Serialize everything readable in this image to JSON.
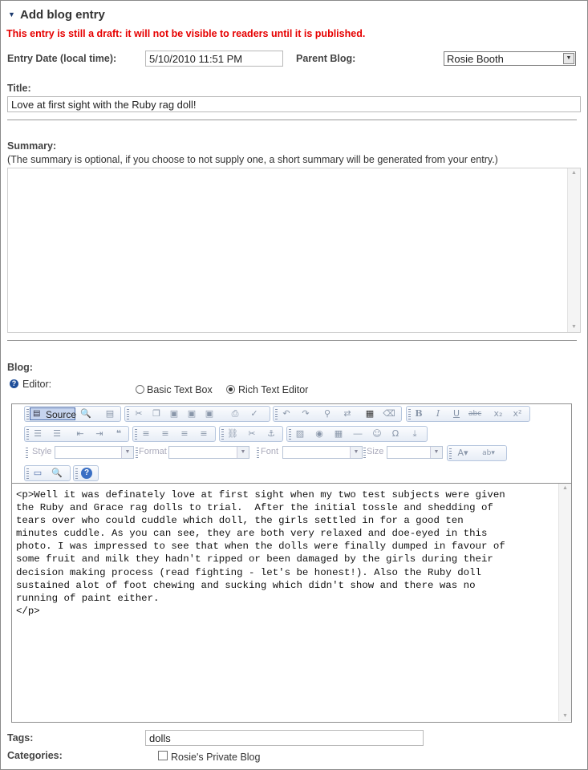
{
  "header": {
    "title": "Add blog entry",
    "warning": "This entry is still a draft: it will not be visible to readers until it is published."
  },
  "entry_date": {
    "label": "Entry Date (local time):",
    "value": "5/10/2010 11:51 PM"
  },
  "parent_blog": {
    "label": "Parent Blog:",
    "value": "Rosie Booth"
  },
  "title_field": {
    "label": "Title:",
    "value": "Love at first sight with the Ruby rag doll!"
  },
  "summary": {
    "label": "Summary:",
    "hint": "(The summary is optional, if you choose to not supply one, a short summary will be generated from your entry.)",
    "value": ""
  },
  "blog": {
    "label": "Blog:",
    "editor_label": "Editor:",
    "basic_label": "Basic Text Box",
    "rich_label": "Rich Text Editor",
    "selected": "rich"
  },
  "toolbar": {
    "source_label": "Source",
    "style_label": "Style",
    "format_label": "Format",
    "font_label": "Font",
    "size_label": "Size"
  },
  "editor_content": "<p>Well it was definately love at first sight when my two test subjects were given\nthe Ruby and Grace rag dolls to trial.  After the initial tossle and shedding of\ntears over who could cuddle which doll, the girls settled in for a good ten\nminutes cuddle. As you can see, they are both very relaxed and doe-eyed in this\nphoto. I was impressed to see that when the dolls were finally dumped in favour of\nsome fruit and milk they hadn't ripped or been damaged by the girls during their\ndecision making process (read fighting - let's be honest!). Also the Ruby doll\nsustained alot of foot chewing and sucking which didn't show and there was no\nrunning of paint either.\n</p>",
  "tags": {
    "label": "Tags:",
    "value": "dolls"
  },
  "categories": {
    "label": "Categories:",
    "item": "Rosie's Private Blog",
    "checked": false
  },
  "colors": {
    "warning": "#e60000",
    "toolbar_border": "#b6c6de",
    "label": "#444444"
  }
}
